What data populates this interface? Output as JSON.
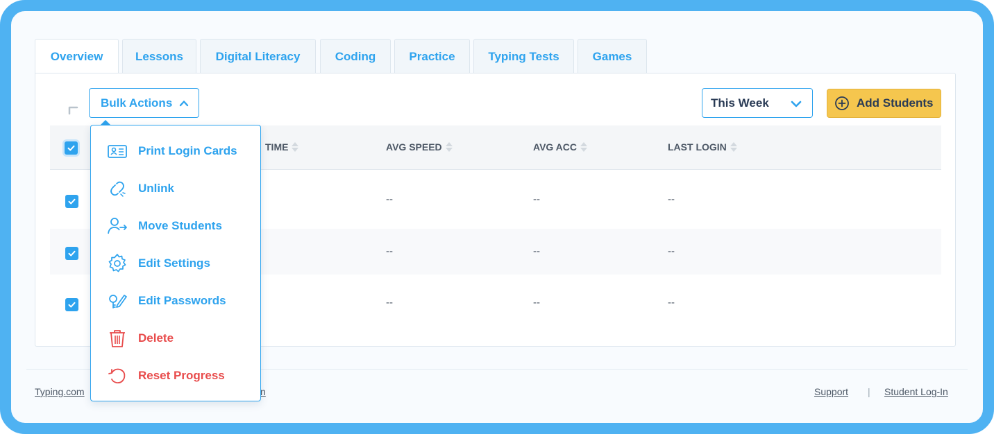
{
  "tabs": [
    {
      "label": "Overview",
      "active": true
    },
    {
      "label": "Lessons"
    },
    {
      "label": "Digital Literacy"
    },
    {
      "label": "Coding"
    },
    {
      "label": "Practice"
    },
    {
      "label": "Typing Tests"
    },
    {
      "label": "Games"
    }
  ],
  "toolbar": {
    "bulk_actions_label": "Bulk Actions",
    "period_select": "This Week",
    "add_students_label": "Add Students"
  },
  "table": {
    "headers": [
      "TIME",
      "AVG SPEED",
      "AVG ACC",
      "LAST LOGIN"
    ],
    "rows": [
      {
        "checked": true,
        "avg_speed": "--",
        "avg_acc": "--",
        "last_login": "--"
      },
      {
        "checked": true,
        "avg_speed": "--",
        "avg_acc": "--",
        "last_login": "--"
      },
      {
        "checked": true,
        "avg_speed": "--",
        "avg_acc": "--",
        "last_login": "--"
      }
    ]
  },
  "bulk_menu": {
    "items": [
      {
        "label": "Print Login Cards",
        "icon": "id-card-icon"
      },
      {
        "label": "Unlink",
        "icon": "broken-link-icon"
      },
      {
        "label": "Move Students",
        "icon": "user-move-icon"
      },
      {
        "label": "Edit Settings",
        "icon": "gear-icon"
      },
      {
        "label": "Edit Passwords",
        "icon": "key-pencil-icon"
      },
      {
        "label": "Delete",
        "icon": "trash-icon"
      },
      {
        "label": "Reset Progress",
        "icon": "reset-icon"
      }
    ]
  },
  "footer": {
    "left_link": "Typing.com",
    "left_link_fragment": "n",
    "support": "Support",
    "separator": "|",
    "student_login": "Student Log-In"
  },
  "colors": {
    "accent": "#2ea3ee",
    "danger": "#e84b4b",
    "button_yellow": "#f5c64e",
    "frame": "#4fb2f2"
  }
}
